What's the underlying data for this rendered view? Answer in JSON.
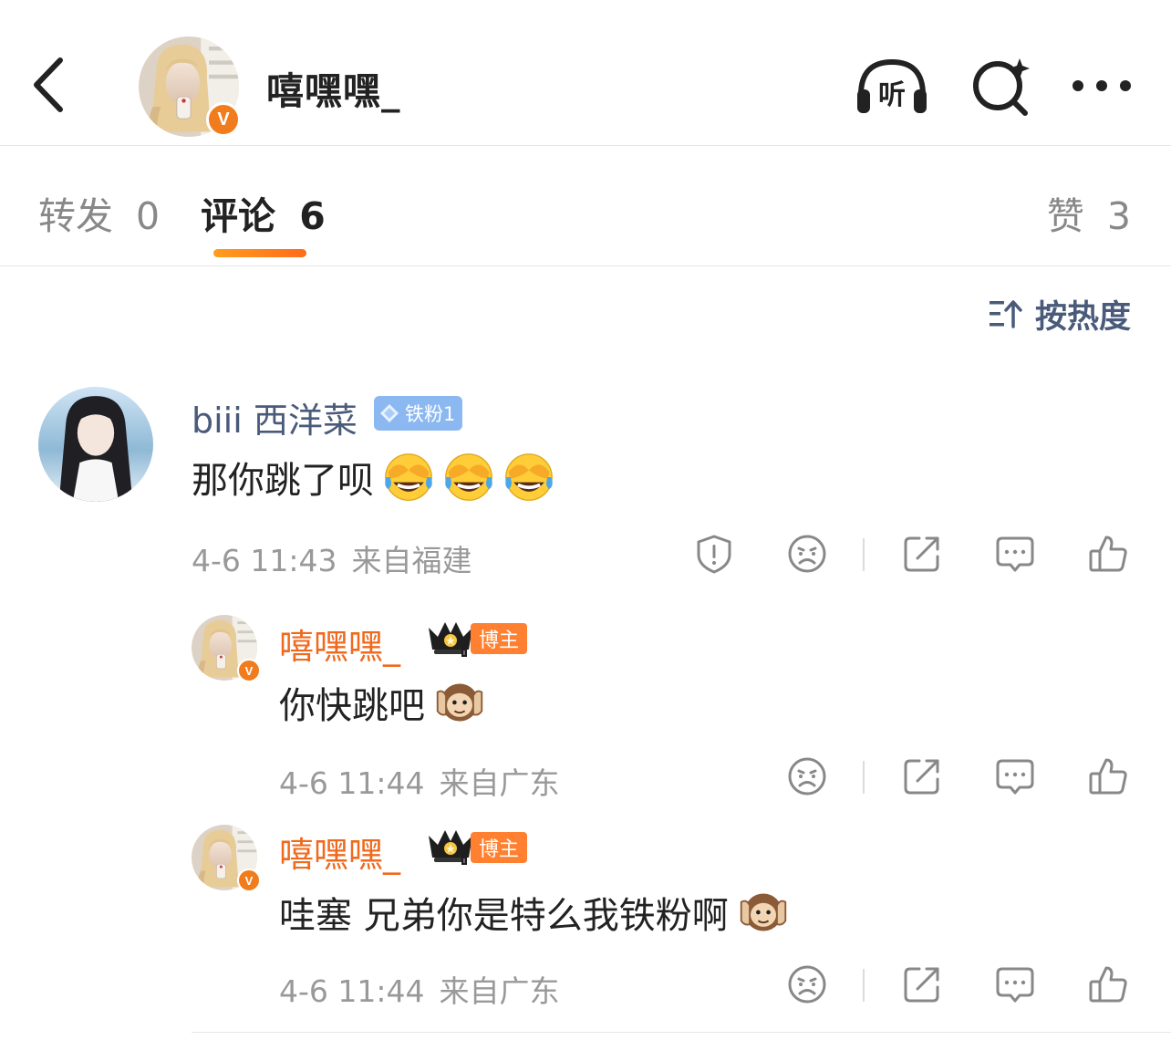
{
  "header": {
    "username": "嘻嘿嘿_",
    "verified_mark": "V",
    "back_icon": "chevron-left-icon",
    "listen_icon": "headphones-listen-icon",
    "listen_label": "听",
    "search_icon": "ai-search-icon",
    "more_icon": "more-dots-icon"
  },
  "tabs": [
    {
      "label": "转发",
      "count": "0"
    },
    {
      "label": "评论",
      "count": "6",
      "active": true
    },
    {
      "label": "赞",
      "count": "3"
    }
  ],
  "sort": {
    "label": "按热度",
    "icon": "sort-icon"
  },
  "comments": [
    {
      "username": "biii 西洋菜",
      "badge": "铁粉1",
      "text": "那你跳了呗",
      "emojis": [
        "laugh-cry-emoji",
        "laugh-cry-emoji",
        "laugh-cry-emoji"
      ],
      "date": "4-6 11:43",
      "location": "来自福建",
      "actions": [
        "report-icon",
        "dislike-icon",
        "share-icon",
        "reply-icon",
        "like-icon"
      ]
    },
    {
      "username": "嘻嘿嘿_",
      "verified_mark": "V",
      "badge": "博主",
      "text": "你快跳吧",
      "emojis": [
        "see-no-evil-monkey-emoji"
      ],
      "date": "4-6 11:44",
      "location": "来自广东",
      "actions": [
        "dislike-icon",
        "share-icon",
        "reply-icon",
        "like-icon"
      ]
    },
    {
      "username": "嘻嘿嘿_",
      "verified_mark": "V",
      "badge": "博主",
      "text": "哇塞 兄弟你是特么我铁粉啊",
      "emojis": [
        "see-no-evil-monkey-emoji"
      ],
      "date": "4-6 11:44",
      "location": "来自广东",
      "actions": [
        "dislike-icon",
        "share-icon",
        "reply-icon",
        "like-icon"
      ]
    }
  ],
  "colors": {
    "accent_orange": "#f06a1e",
    "badge_blue": "#8cb8f2",
    "meta_gray": "#999999",
    "username_blue": "#4a5a7a"
  }
}
